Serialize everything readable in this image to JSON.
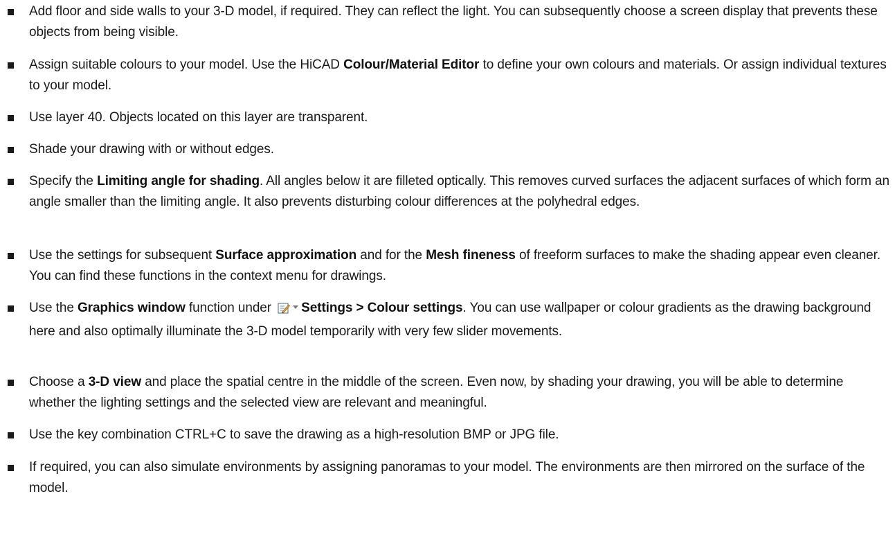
{
  "tips": [
    {
      "parts": [
        {
          "t": "Add floor and side walls to your 3-D model, if required. They can reflect the light. You can subsequently choose a screen display that prevents these objects from being visible."
        }
      ]
    },
    {
      "parts": [
        {
          "t": "Assign suitable colours to your model. Use the HiCAD "
        },
        {
          "t": "Colour/Material Editor",
          "b": true
        },
        {
          "t": " to define your own colours and materials. Or assign individual textures to your model."
        }
      ]
    },
    {
      "parts": [
        {
          "t": "Use layer 40. Objects located on this layer are transparent."
        }
      ]
    },
    {
      "parts": [
        {
          "t": "Shade your drawing with or without edges."
        }
      ]
    },
    {
      "parts": [
        {
          "t": "Specify the "
        },
        {
          "t": "Limiting angle for shading",
          "b": true
        },
        {
          "t": ". All angles below it are filleted optically. This removes curved surfaces the adjacent surfaces of which form an angle smaller than the limiting angle. It also prevents disturbing colour differences at the polyhedral edges."
        }
      ]
    },
    {
      "parts": [
        {
          "t": "Use the settings for subsequent "
        },
        {
          "t": "Surface approximation",
          "b": true
        },
        {
          "t": " and for the "
        },
        {
          "t": "Mesh fineness",
          "b": true
        },
        {
          "t": " of freeform surfaces to make the shading appear even cleaner. You can find these functions in the context menu for drawings."
        }
      ]
    },
    {
      "parts": [
        {
          "t": "Use the "
        },
        {
          "t": "Graphics window",
          "b": true
        },
        {
          "t": " function under "
        },
        {
          "icon": "settings-pencil-icon"
        },
        {
          "t": "Settings > Colour settings",
          "b": true
        },
        {
          "t": ". You can use wallpaper or colour gradients as the drawing background here and also optimally illuminate the 3-D model temporarily with very few slider movements."
        }
      ]
    },
    {
      "parts": [
        {
          "t": "Choose a "
        },
        {
          "t": "3-D view",
          "b": true
        },
        {
          "t": " and place the spatial centre in the middle of the screen. Even now, by shading your drawing, you will be able to determine whether the lighting settings and the selected view are relevant and meaningful."
        }
      ]
    },
    {
      "parts": [
        {
          "t": "Use the key combination CTRL+C to save the drawing as a high-resolution BMP or JPG file."
        }
      ]
    },
    {
      "parts": [
        {
          "t": "If required, you can also simulate environments by assigning panoramas to your model. The environments are then mirrored on the surface of the model."
        }
      ]
    }
  ]
}
